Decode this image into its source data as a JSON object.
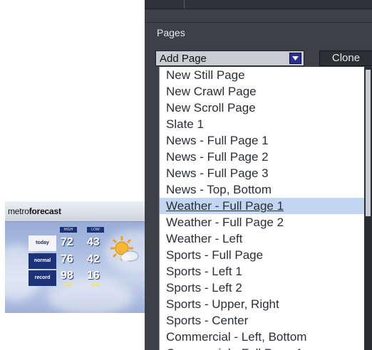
{
  "panel": {
    "section_label": "Pages",
    "combo_value": "Add Page",
    "clone_label": "Clone"
  },
  "dropdown": {
    "items": [
      "New Still Page",
      "New Crawl Page",
      "New Scroll Page",
      "Slate 1",
      "News - Full Page 1",
      "News - Full Page 2",
      "News - Full Page 3",
      "News - Top, Bottom",
      "Weather - Full Page 1",
      "Weather - Full Page 2",
      "Weather - Left",
      "Sports - Full Page",
      "Sports - Left 1",
      "Sports - Left 2",
      "Sports - Upper, Right",
      "Sports - Center",
      "Commercial - Left, Bottom",
      "Commercial - Full Page 1"
    ],
    "selected_index": 8,
    "selection_color": "#c2d6f2"
  },
  "preview": {
    "logo_light": "metro",
    "logo_bold": "forecast",
    "col_high": "HIGH",
    "col_low": "LOW",
    "rows": [
      {
        "label": "today",
        "high": "72",
        "low": "43"
      },
      {
        "label": "normal",
        "high": "76",
        "low": "42"
      },
      {
        "label": "record",
        "high": "98",
        "low": "16",
        "high_year": "1987",
        "low_year": "1946"
      }
    ],
    "icon": "sun-cloud-icon"
  }
}
